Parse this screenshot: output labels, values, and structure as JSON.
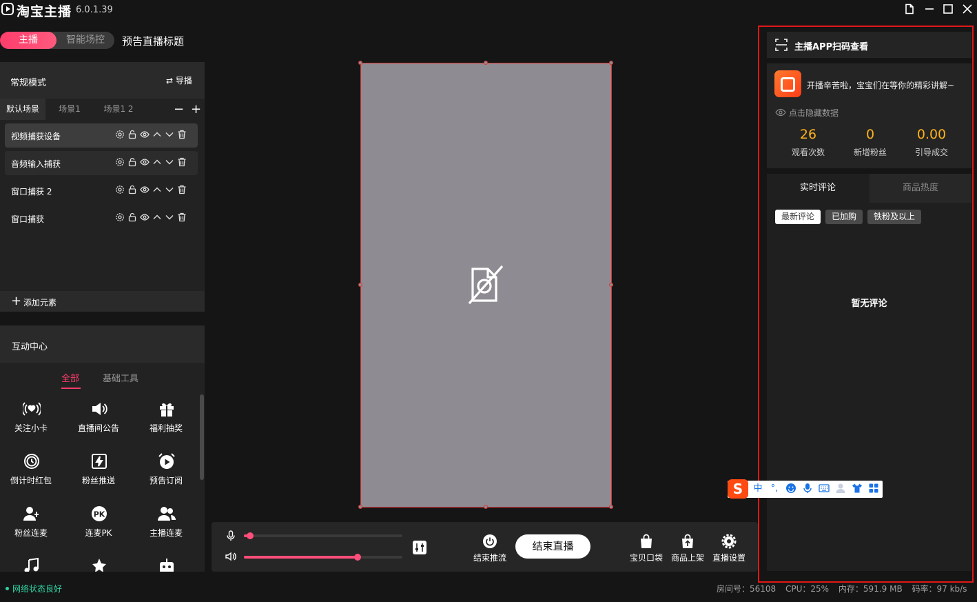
{
  "app": {
    "name": "淘宝主播",
    "version": "6.0.1.39"
  },
  "top": {
    "mode_active": "主播",
    "mode_other": "智能场控",
    "preview_title": "预告直播标题"
  },
  "scene": {
    "mode": "常规模式",
    "guide": "导播",
    "tabs": [
      "默认场景",
      "场景1",
      "场景1 2"
    ],
    "sources": [
      "视频捕获设备",
      "音频输入捕获",
      "窗口捕获 2",
      "窗口捕获"
    ],
    "add_element": "添加元素"
  },
  "interaction": {
    "title": "互动中心",
    "tabs": [
      "全部",
      "基础工具"
    ],
    "tools": [
      "关注小卡",
      "直播间公告",
      "福利抽奖",
      "倒计时红包",
      "粉丝推送",
      "预告订阅",
      "粉丝连麦",
      "连麦PK",
      "主播连麦"
    ]
  },
  "audio": {
    "mic_level": 0.02,
    "volume_level": 0.7
  },
  "bottom": {
    "end_stream": "结束推流",
    "end_live": "结束直播",
    "items": [
      "宝贝口袋",
      "商品上架",
      "直播设置"
    ]
  },
  "right": {
    "qr_title": "主播APP扫码查看",
    "welcome": "开播辛苦啦，宝宝们在等你的精彩讲解~",
    "hide_data": "点击隐藏数据",
    "stats": [
      {
        "value": "26",
        "label": "观看次数"
      },
      {
        "value": "0",
        "label": "新增粉丝"
      },
      {
        "value": "0.00",
        "label": "引导成交"
      }
    ],
    "comment_tabs": [
      "实时评论",
      "商品热度"
    ],
    "filters": [
      "最新评论",
      "已加购",
      "铁粉及以上"
    ],
    "empty": "暂无评论"
  },
  "ime": {
    "logo": "S",
    "lang": "中",
    "punct": "°,"
  },
  "status": {
    "network": "网络状态良好",
    "room": "房间号：56108",
    "cpu": "CPU：25%",
    "memory": "内存：591.9 MB",
    "bitrate": "码率：97 kb/s",
    "more": ">"
  },
  "colors": {
    "accent": "#ff3d6b",
    "stat_value": "#ffb21a",
    "frame_red": "#e01818",
    "network_ok": "#2ed3a0"
  }
}
